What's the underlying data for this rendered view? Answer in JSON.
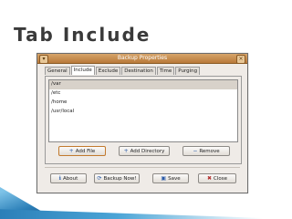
{
  "slide": {
    "title": "Tab Include"
  },
  "window": {
    "title": "Backup Properties",
    "tabs": [
      {
        "label": "General",
        "active": false
      },
      {
        "label": "Include",
        "active": true
      },
      {
        "label": "Exclude",
        "active": false
      },
      {
        "label": "Destination",
        "active": false
      },
      {
        "label": "Time",
        "active": false
      },
      {
        "label": "Purging",
        "active": false
      }
    ],
    "include_list": [
      "/var",
      "/etc",
      "/home",
      "/usr/local"
    ],
    "panel_buttons": {
      "add_file": "Add File",
      "add_directory": "Add Directory",
      "remove": "Remove"
    },
    "bottom_buttons": {
      "about": "About",
      "backup_now": "Backup Now!",
      "save": "Save",
      "close": "Close"
    }
  },
  "colors": {
    "titlebar": "#c8914f",
    "accent": "#2b7fb8"
  }
}
